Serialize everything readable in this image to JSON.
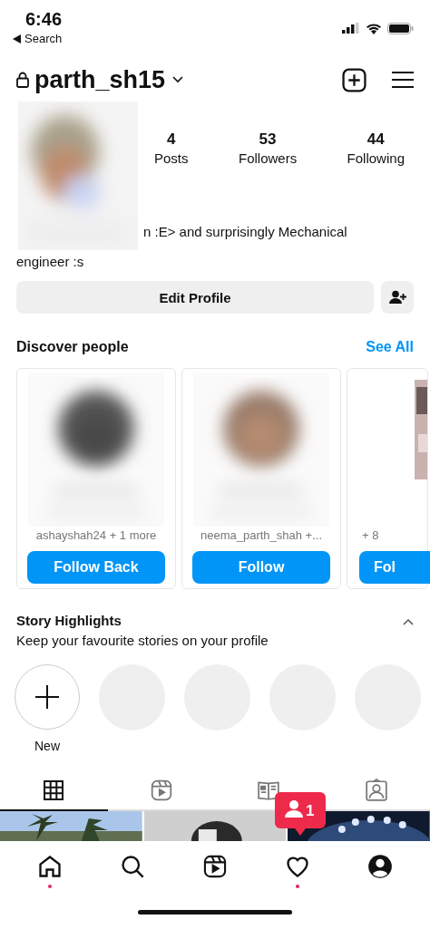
{
  "status_bar": {
    "time": "6:46",
    "back_label": "Search"
  },
  "header": {
    "username": "parth_sh15"
  },
  "stats": [
    {
      "value": "4",
      "label": "Posts"
    },
    {
      "value": "53",
      "label": "Followers"
    },
    {
      "value": "44",
      "label": "Following"
    }
  ],
  "bio": {
    "line_1": "n :E> and surprisingly Mechanical",
    "line_2": "engineer :s"
  },
  "edit_profile_label": "Edit Profile",
  "discover": {
    "title": "Discover people",
    "see_all": "See All",
    "cards": [
      {
        "subtitle": "ashayshah24 + 1 more",
        "button": "Follow Back"
      },
      {
        "subtitle": "neema_parth_shah +...",
        "button": "Follow"
      },
      {
        "subtitle": "+ 8",
        "button": "Fol"
      }
    ]
  },
  "highlights": {
    "title": "Story Highlights",
    "subtitle": "Keep your favourite stories on your profile",
    "expanded": true,
    "new_label": "New",
    "placeholders": [
      {
        "kind": "empty"
      },
      {
        "kind": "empty"
      },
      {
        "kind": "empty"
      },
      {
        "kind": "empty"
      }
    ]
  },
  "profile_tabs": [
    {
      "kind": "grid",
      "selected": true
    },
    {
      "kind": "reels",
      "selected": false
    },
    {
      "kind": "guides",
      "selected": false
    },
    {
      "kind": "tagged",
      "selected": false
    }
  ],
  "notification_badge": {
    "count": "1"
  },
  "nav": [
    {
      "kind": "home",
      "dot": true
    },
    {
      "kind": "search",
      "dot": false
    },
    {
      "kind": "reels",
      "dot": false
    },
    {
      "kind": "heart",
      "dot": true
    },
    {
      "kind": "profile",
      "dot": false
    }
  ]
}
